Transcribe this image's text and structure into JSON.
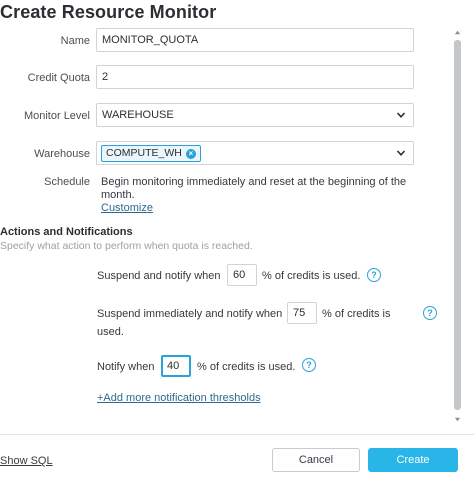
{
  "dialog": {
    "title": "Create Resource Monitor"
  },
  "form": {
    "name": {
      "label": "Name",
      "value": "MONITOR_QUOTA"
    },
    "credit_quota": {
      "label": "Credit Quota",
      "value": "2"
    },
    "monitor_level": {
      "label": "Monitor Level",
      "value": "WAREHOUSE"
    },
    "warehouse": {
      "label": "Warehouse",
      "chip": "COMPUTE_WH"
    },
    "schedule": {
      "label": "Schedule",
      "text": "Begin monitoring immediately and reset at the beginning of the month.",
      "customize_link": "Customize"
    }
  },
  "actions": {
    "title": "Actions and Notifications",
    "subtitle": "Specify what action to perform when quota is reached.",
    "suspend_notify": {
      "before": "Suspend and notify when",
      "value": "60",
      "after": "% of credits is used."
    },
    "suspend_immediately": {
      "before": "Suspend immediately and notify when",
      "value": "75",
      "after": "% of credits is",
      "after2": "used."
    },
    "notify": {
      "before": "Notify when",
      "value": "40",
      "after": "% of credits is used."
    },
    "add_more_link": "+Add more notification thresholds",
    "help_glyph": "?"
  },
  "footer": {
    "show_sql": "Show SQL",
    "cancel": "Cancel",
    "create": "Create"
  },
  "icons": {
    "dropdown": "chevron-down-icon",
    "chip_remove": "close-circle-icon",
    "help": "help-circle-icon"
  },
  "colors": {
    "accent": "#29b5e8",
    "chip_border": "#29a3d6",
    "link": "#2e6a8e"
  }
}
